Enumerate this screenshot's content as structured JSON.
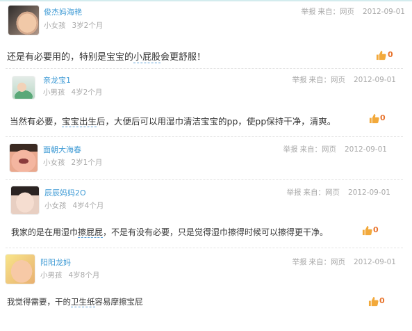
{
  "colors": {
    "name": "#3f9bd5",
    "meta": "#a8a8a8",
    "body": "#333333",
    "like_count": "#e8742e",
    "like_icon": "#f2a93b"
  },
  "like_icon": "thumbs-up-icon",
  "comments": [
    {
      "name": "俊杰妈海艳",
      "gender": "小女孩",
      "age": "3岁2个月",
      "report": "举报",
      "source_label": "来自：",
      "source": "网页",
      "date": "2012-09-01",
      "body_before": "还是有必要用的，特别是宝宝的",
      "body_link": "小屁股",
      "body_after": "会更舒服！",
      "likes": "0"
    },
    {
      "name": "亲龙宝1",
      "gender": "小男孩",
      "age": "4岁2个月",
      "report": "举报",
      "source_label": "来自：",
      "source": "网页",
      "date": "2012-09-01",
      "body_before": "当然有必要，",
      "body_link": "宝宝出生",
      "body_after": "后，大便后可以用湿巾清洁宝宝的pp，使pp保持干净，清爽。",
      "likes": "0"
    },
    {
      "name": "面朝大海春",
      "gender": "小女孩",
      "age": "2岁1个月",
      "report": "举报",
      "source_label": "来自：",
      "source": "网页",
      "date": "2012-09-01"
    },
    {
      "name": "辰辰妈妈2O",
      "gender": "小女孩",
      "age": "4岁4个月",
      "report": "举报",
      "source_label": "来自：",
      "source": "网页",
      "date": "2012-09-01",
      "body_before": "我家的是在用湿巾",
      "body_link": "擦屁屁",
      "body_after": "，不是有没有必要，只是觉得湿巾擦得时候可以擦得更干净。",
      "likes": "0"
    },
    {
      "name": "阳阳龙妈",
      "gender": "小男孩",
      "age": "4岁8个月",
      "report": "举报",
      "source_label": "来自：",
      "source": "网页",
      "date": "2012-09-01",
      "body_before": "我觉得需要，干的",
      "body_link": "卫生纸",
      "body_after": "容易摩擦宝屁",
      "likes": "0"
    }
  ]
}
